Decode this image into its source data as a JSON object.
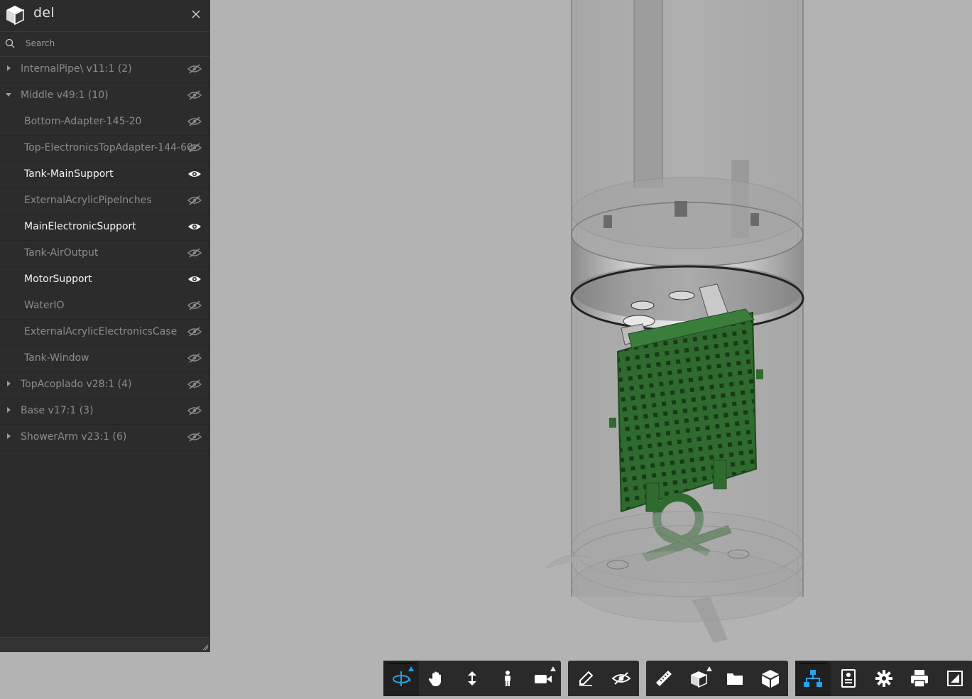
{
  "panel": {
    "title": "del",
    "search_placeholder": "Search",
    "items": [
      {
        "label": "InternalPipe\\ v11:1 (2)",
        "level": "top",
        "expanded": false,
        "visible": false
      },
      {
        "label": "Middle v49:1 (10)",
        "level": "top",
        "expanded": true,
        "visible": false
      },
      {
        "label": "Bottom-Adapter-145-20",
        "level": "child",
        "visible": false
      },
      {
        "label": "Top-ElectronicsTopAdapter-144-60",
        "level": "child",
        "visible": false
      },
      {
        "label": "Tank-MainSupport",
        "level": "child",
        "visible": true
      },
      {
        "label": "ExternalAcrylicPipeInches",
        "level": "child",
        "visible": false
      },
      {
        "label": "MainElectronicSupport",
        "level": "child",
        "visible": true
      },
      {
        "label": "Tank-AirOutput",
        "level": "child",
        "visible": false
      },
      {
        "label": "MotorSupport",
        "level": "child",
        "visible": true
      },
      {
        "label": "WaterIO",
        "level": "child",
        "visible": false
      },
      {
        "label": "ExternalAcrylicElectronicsCase",
        "level": "child",
        "visible": false
      },
      {
        "label": "Tank-Window",
        "level": "child",
        "visible": false
      },
      {
        "label": "TopAcoplado v28:1 (4)",
        "level": "top",
        "expanded": false,
        "visible": false
      },
      {
        "label": "Base v17:1 (3)",
        "level": "top",
        "expanded": false,
        "visible": false
      },
      {
        "label": "ShowerArm v23:1 (6)",
        "level": "top",
        "expanded": false,
        "visible": false
      }
    ]
  },
  "toolbar": {
    "groups": [
      [
        "orbit-icon",
        "pan-icon",
        "dolly-icon",
        "first-person-icon",
        "camera-icon"
      ],
      [
        "markup-pencil-icon",
        "hide-icon"
      ],
      [
        "measure-icon",
        "section-box-icon",
        "explode-folder-icon",
        "model-cube-icon"
      ],
      [
        "model-browser-icon",
        "properties-icon",
        "settings-gear-icon",
        "print-icon",
        "fullscreen-icon"
      ]
    ],
    "active": [
      "orbit-icon",
      "model-browser-icon"
    ]
  },
  "colors": {
    "accent": "#29a3e6",
    "panel_bg": "#2c2c2c",
    "viewport_bg": "#b3b3b3",
    "part_green": "#2f6b2f"
  }
}
